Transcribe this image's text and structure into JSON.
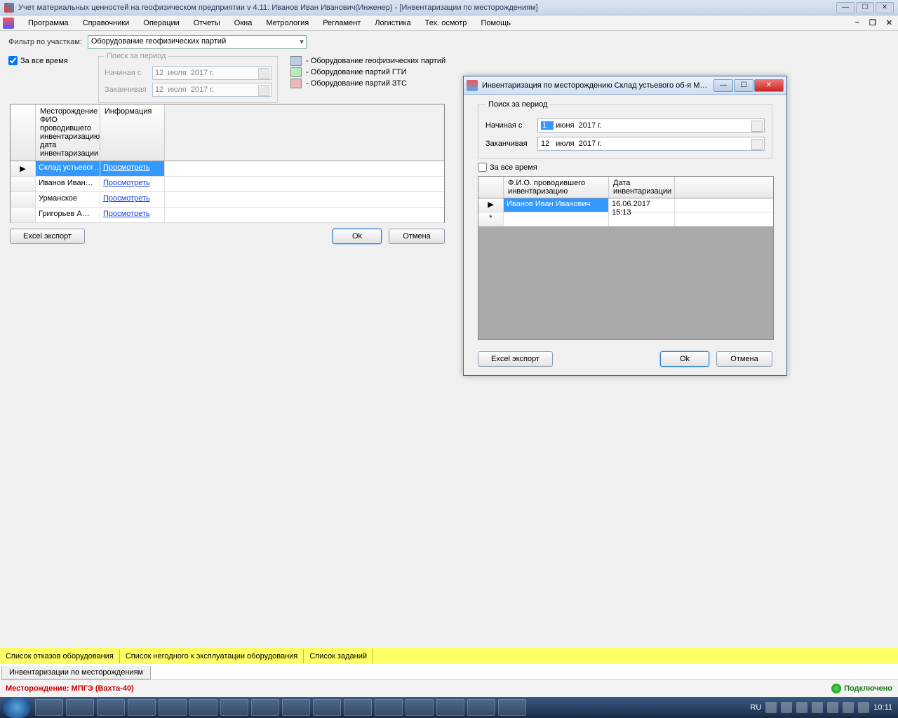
{
  "window": {
    "title": "Учет материальных ценностей на геофизическом предприятии v 4.11: Иванов Иван Иванович(Инженер) - [Инвентаризации по месторождениям]"
  },
  "menu": {
    "items": [
      "Программа",
      "Справочники",
      "Операции",
      "Отчеты",
      "Окна",
      "Метрология",
      "Регламент",
      "Логистика",
      "Тех. осмотр",
      "Помощь"
    ]
  },
  "filter": {
    "label": "Фильтр по участкам:",
    "combo": "Оборудование геофизических партий",
    "all_time": "За все время"
  },
  "period": {
    "legend": "Поиск за период",
    "from_label": "Начиная с",
    "to_label": "Заканчивая",
    "from": {
      "d": "12",
      "m": "июля",
      "y": "2017 г."
    },
    "to": {
      "d": "12",
      "m": "июля",
      "y": "2017 г."
    }
  },
  "legend": {
    "items": [
      {
        "color": "#b7cdea",
        "label": "- Оборудование геофизических партий"
      },
      {
        "color": "#b7eac1",
        "label": "- Оборудование партий ГТИ"
      },
      {
        "color": "#eab7b7",
        "label": "- Оборудование партий ЗТС"
      }
    ]
  },
  "grid": {
    "cols": [
      "",
      "Месторождение ФИО проводившего инвентаризацию, дата инвентаризации",
      "Информация"
    ],
    "rows": [
      {
        "mark": "▶",
        "a": "Склад устьевог…",
        "b": "Просмотреть",
        "sel": true
      },
      {
        "mark": "",
        "a": "Иванов Иван…",
        "b": "Просмотреть"
      },
      {
        "mark": "",
        "a": "Урманское",
        "b": "Просмотреть"
      },
      {
        "mark": "",
        "a": "Григорьев А…",
        "b": "Просмотреть"
      }
    ]
  },
  "buttons": {
    "excel": "Excel экспорт",
    "ok": "Ok",
    "cancel": "Отмена"
  },
  "yellow_tabs": [
    "Список отказов оборудования",
    "Список негодного к эксплуатации оборудования",
    "Список заданий"
  ],
  "bottom_tab": "Инвентаризации по месторождениям",
  "status": {
    "loc": "Месторождение: МПГЭ (Вахта-40)",
    "conn": "Подключено"
  },
  "dialog": {
    "title": "Инвентаризация по месторождению Склад устьевого об-я М…",
    "period": {
      "legend": "Поиск за период",
      "from_label": "Начиная с",
      "to_label": "Заканчивая",
      "from": {
        "d": "1",
        "m": "июня",
        "y": "2017 г."
      },
      "to": {
        "d": "12",
        "m": "июля",
        "y": "2017 г."
      }
    },
    "all_time": "За все время",
    "grid": {
      "cols": [
        "",
        "Ф.И.О. проводившего инвентаризацию",
        "Дата инвентаризации"
      ],
      "rows": [
        {
          "mark": "▶",
          "a": "Иванов Иван Иванович",
          "b": "16.06.2017 15:13",
          "sel": true
        },
        {
          "mark": "*",
          "a": "",
          "b": ""
        }
      ]
    },
    "buttons": {
      "excel": "Excel экспорт",
      "ok": "Ok",
      "cancel": "Отмена"
    }
  },
  "taskbar": {
    "lang": "RU",
    "clock": "10:11"
  }
}
